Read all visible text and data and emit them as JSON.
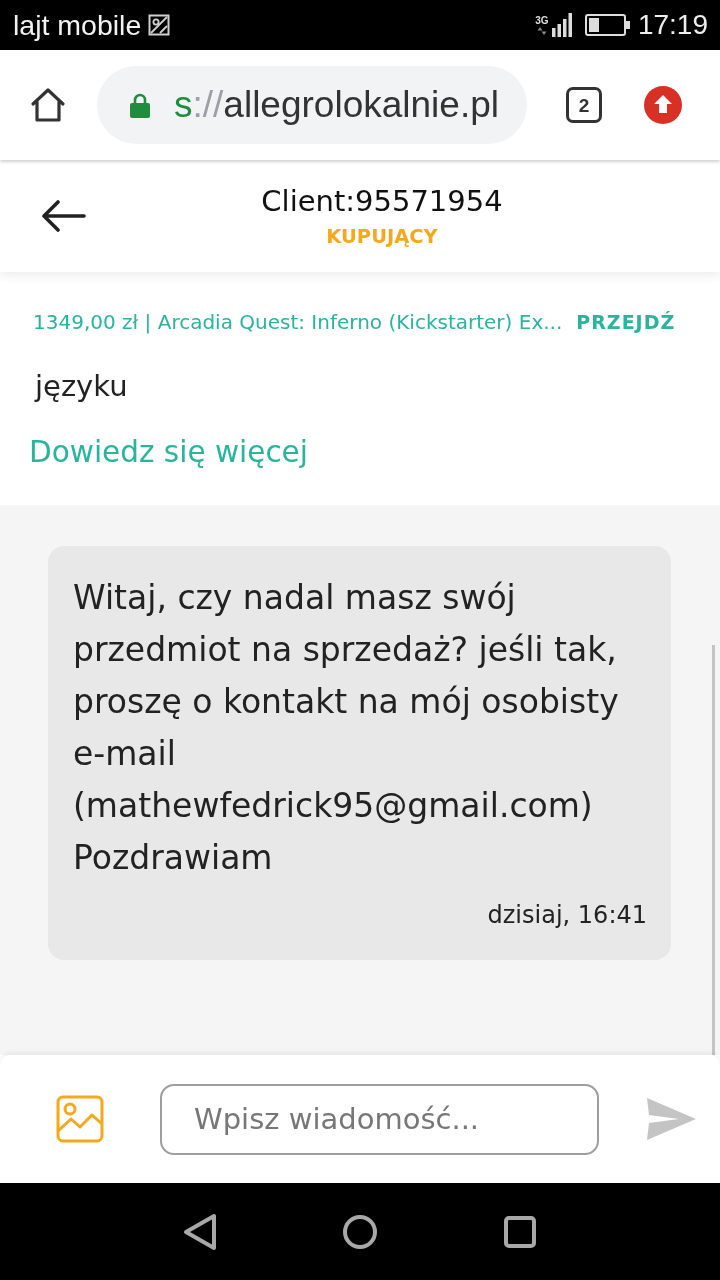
{
  "status_bar": {
    "carrier": "lajt mobile",
    "network": "3G",
    "time": "17:19"
  },
  "browser": {
    "url_scheme": "s",
    "url_separator": "://",
    "url_host": "allegrolokalnie.pl",
    "tab_count": "2"
  },
  "header": {
    "title": "Client:95571954",
    "role": "KUPUJĄCY"
  },
  "offer": {
    "summary": "1349,00 zł | Arcadia Quest: Inferno (Kickstarter) Ex...",
    "action": "PRZEJDŹ"
  },
  "notice": {
    "text": "języku",
    "link": "Dowiedz się więcej"
  },
  "messages": [
    {
      "text": "Witaj, czy nadal masz swój przedmiot na sprzedaż? jeśli tak, proszę o kontakt na mój osobisty e-mail (mathewfedrick95@gmail.com) Pozdrawiam",
      "time": "dzisiaj, 16:41"
    }
  ],
  "composer": {
    "placeholder": "Wpisz wiadomość..."
  }
}
